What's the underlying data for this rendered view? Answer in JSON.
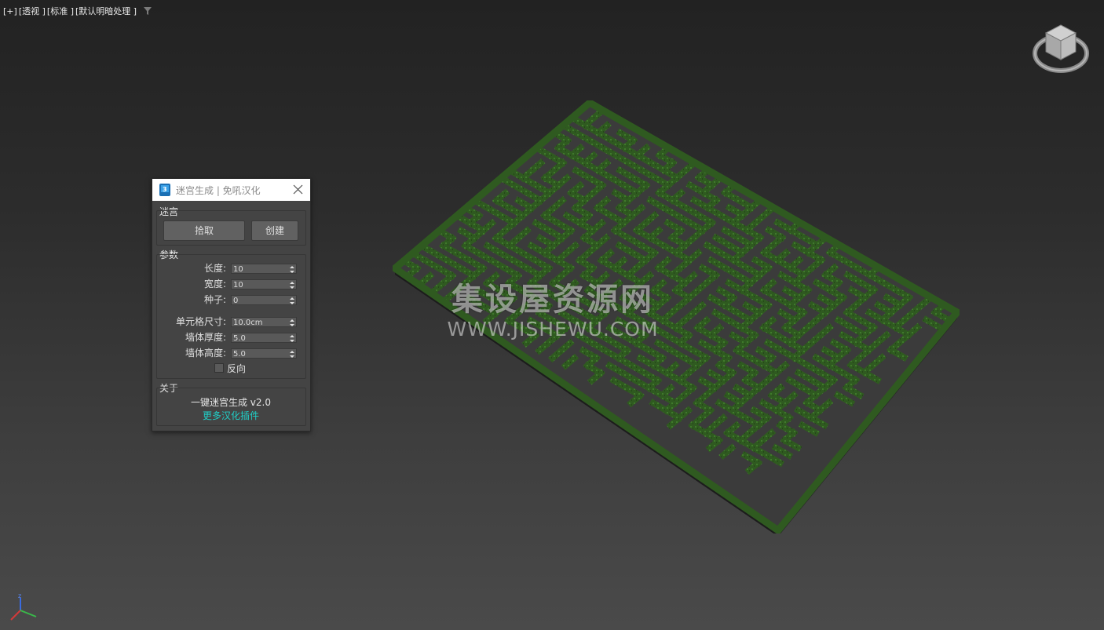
{
  "viewport": {
    "labels": [
      "[+]",
      "[透视 ]",
      "[标准 ]",
      "[默认明暗处理 ]"
    ]
  },
  "watermark": {
    "cn": "集设屋资源网",
    "en": "WWW.JISHEWU.COM"
  },
  "axis": {
    "z_label": "z"
  },
  "dialog": {
    "title": "迷宫生成 | 免吼汉化",
    "maze_group": {
      "title": "迷宫",
      "pick_label": "拾取",
      "create_label": "创建"
    },
    "params_group": {
      "title": "参数",
      "rows": [
        {
          "label": "长度:",
          "value": "10"
        },
        {
          "label": "宽度:",
          "value": "10"
        },
        {
          "label": "种子:",
          "value": "0"
        },
        {
          "label": "单元格尺寸:",
          "value": "10.0cm"
        },
        {
          "label": "墙体厚度:",
          "value": "5.0"
        },
        {
          "label": "墙体高度:",
          "value": "5.0"
        }
      ],
      "reverse_label": "反向",
      "reverse_checked": false
    },
    "about_group": {
      "title": "关于",
      "product": "一键迷宫生成 v2.0",
      "link": "更多汉化插件"
    }
  },
  "colors": {
    "link": "#1fd0c8",
    "maze_wall": "#2f5a20",
    "maze_floor": "#3a3a3a"
  }
}
